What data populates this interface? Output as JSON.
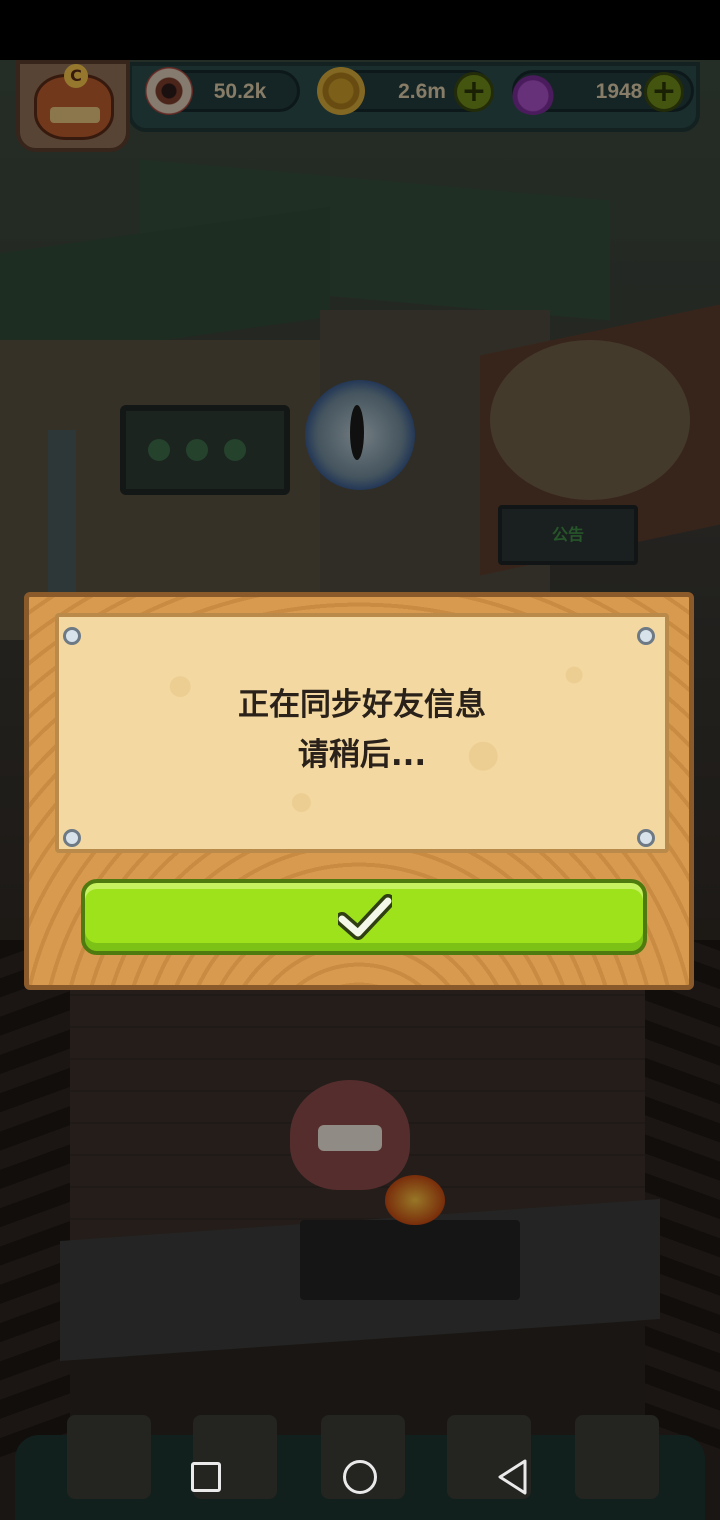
{
  "hud": {
    "eyeball_count": "50.2k",
    "coin_count": "2.6m",
    "potion_count": "1948",
    "avatar_badge": "C",
    "icons": [
      "eyeball-icon",
      "coin-icon",
      "potion-icon",
      "plus-icon"
    ]
  },
  "scene": {
    "notice_board": "公告"
  },
  "dialog": {
    "line1": "正在同步好友信息",
    "line2": "请稍后...",
    "confirm_icon": "checkmark-icon"
  },
  "colors": {
    "confirm_button": "#9ee21c",
    "dialog_wood": "#d79a4f",
    "dialog_paper": "#f3d9a1",
    "hud_teal": "#2b4b4a"
  },
  "navbar": {
    "icons": [
      "recent-apps-icon",
      "home-icon",
      "back-icon"
    ]
  }
}
